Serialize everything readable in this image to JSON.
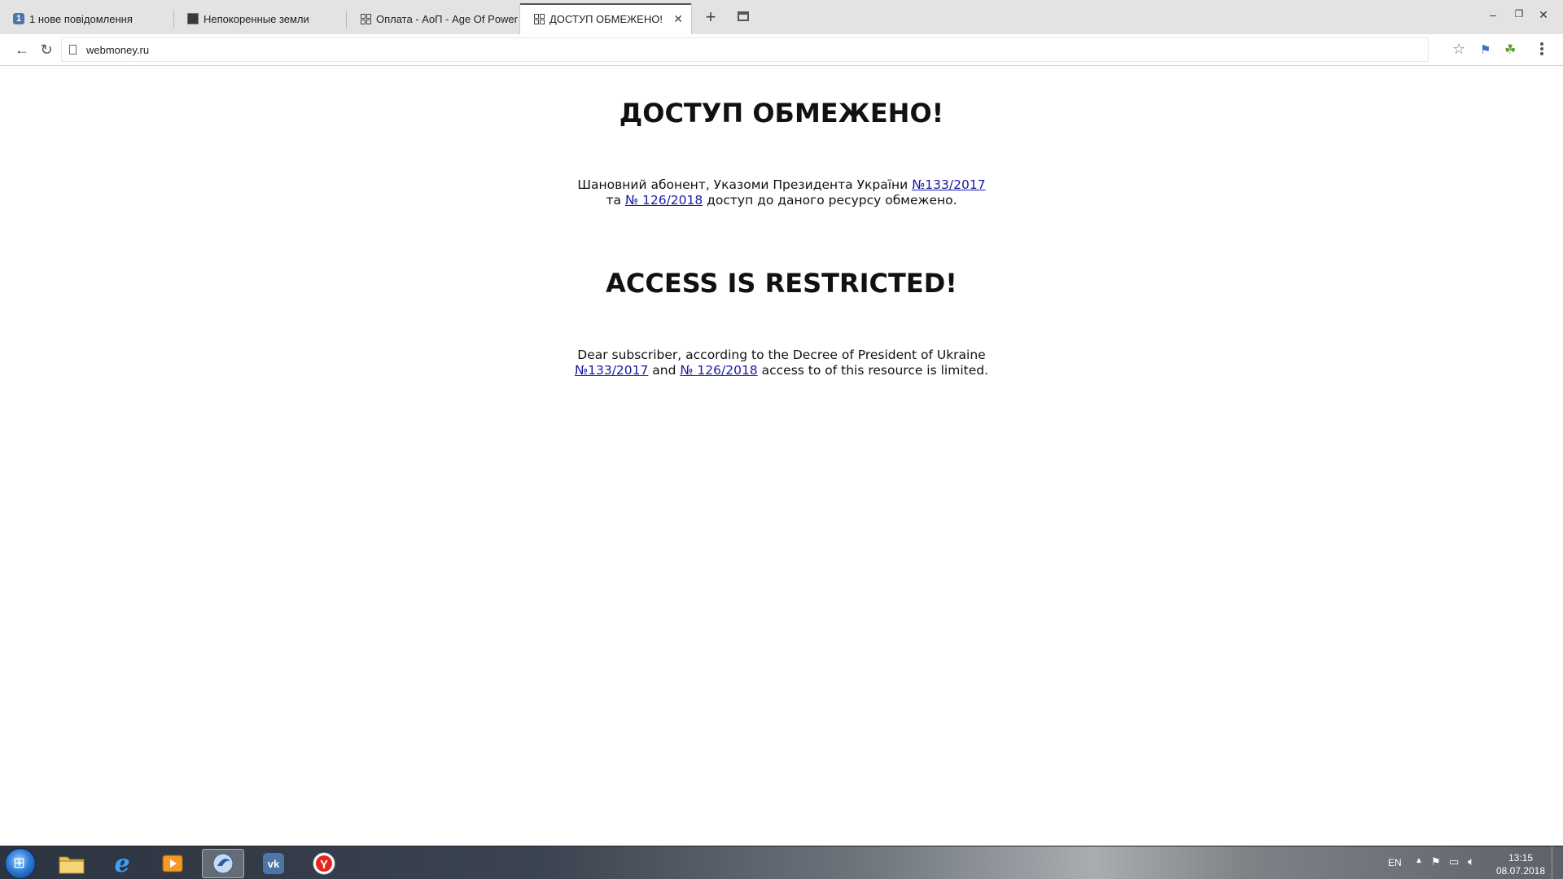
{
  "browser": {
    "tabs": [
      {
        "title": "1 нове повідомлення",
        "favicon": "vk-badge-icon",
        "badge": "1"
      },
      {
        "title": "Непокоренные земли",
        "favicon": "game-icon"
      },
      {
        "title": "Оплата - АоП - Age Of Power",
        "favicon": "grid-icon"
      },
      {
        "title": "ДОСТУП ОБМЕЖЕНО! | ACCESS IS RESTRICTED!",
        "favicon": "grid-icon",
        "active": true
      }
    ],
    "url": "webmoney.ru"
  },
  "page": {
    "ua": {
      "heading": "ДОСТУП ОБМЕЖЕНО!",
      "text_before": "Шановний абонент, Указоми Президента України ",
      "link1": "№133/2017",
      "text_mid": " та ",
      "link2": "№ 126/2018",
      "text_after": " доступ до даного ресурсу обмежено."
    },
    "en": {
      "heading": "ACCESS IS RESTRICTED!",
      "text_before": "Dear subscriber, according to the Decree of President of Ukraine ",
      "link1": "№133/2017",
      "text_mid": " and ",
      "link2": "№ 126/2018",
      "text_after": " access to of this resource is limited."
    }
  },
  "taskbar": {
    "language": "EN",
    "time": "13:15",
    "date": "08.07.2018"
  },
  "colors": {
    "link": "#1a1aa6",
    "tabstrip": "#e3e3e3"
  }
}
